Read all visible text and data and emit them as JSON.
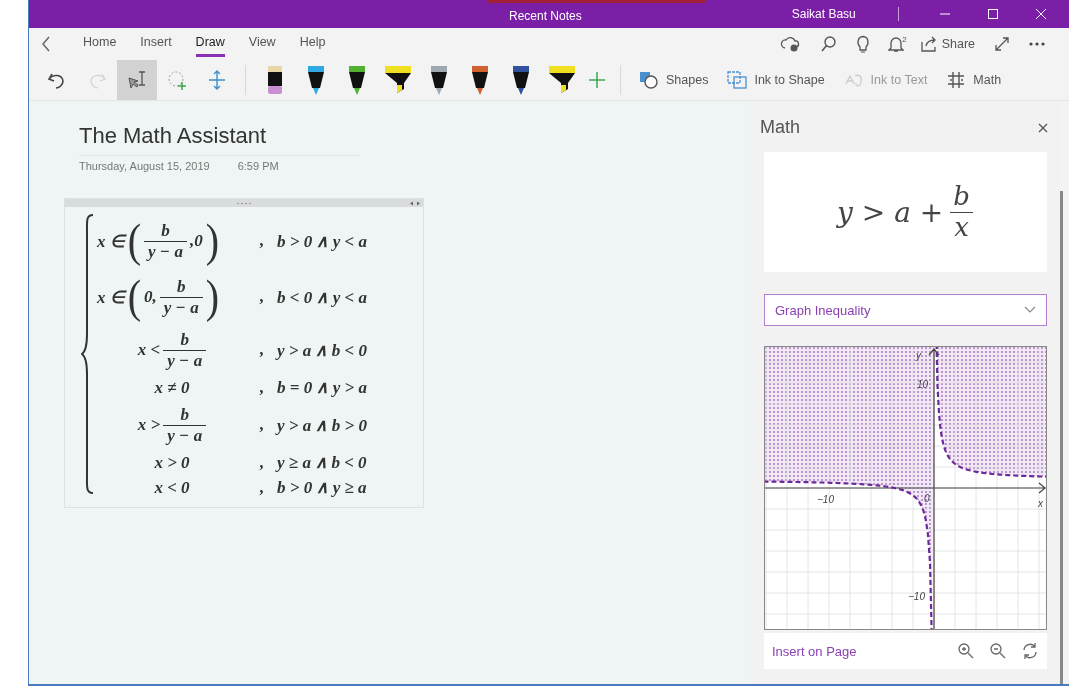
{
  "title_bar": {
    "title": "Recent Notes",
    "user": "Saikat Basu"
  },
  "ribbon_tabs": [
    {
      "label": "Home",
      "selected": false
    },
    {
      "label": "Insert",
      "selected": false
    },
    {
      "label": "Draw",
      "selected": true
    },
    {
      "label": "View",
      "selected": false
    },
    {
      "label": "Help",
      "selected": false
    }
  ],
  "top_actions": [
    {
      "kind": "sync"
    },
    {
      "kind": "search"
    },
    {
      "kind": "lightbulb"
    },
    {
      "kind": "bell",
      "badge": "2"
    },
    {
      "kind": "share",
      "label": "Share"
    },
    {
      "kind": "expand"
    },
    {
      "kind": "more"
    }
  ],
  "history_tools": [
    {
      "kind": "undo",
      "disabled": false
    },
    {
      "kind": "redo",
      "disabled": true
    }
  ],
  "draw_tools": [
    {
      "kind": "type-select",
      "selected": true
    },
    {
      "kind": "lasso",
      "selected": false
    },
    {
      "kind": "space",
      "selected": false
    }
  ],
  "pens": [
    {
      "kind": "marker",
      "color": "#c890d0"
    },
    {
      "kind": "pen",
      "color": "#30a8e0"
    },
    {
      "kind": "pen",
      "color": "#50b030"
    },
    {
      "kind": "highlighter",
      "color": "#f0e020"
    },
    {
      "kind": "pen",
      "color": "#a0a8b0"
    },
    {
      "kind": "pen",
      "color": "#d06030"
    },
    {
      "kind": "pen",
      "color": "#3050a0"
    },
    {
      "kind": "highlighter",
      "color": "#f0e020"
    }
  ],
  "ink_actions": [
    {
      "kind": "shapes",
      "label": "Shapes",
      "disabled": false
    },
    {
      "kind": "ink-to-shape",
      "label": "Ink to Shape",
      "disabled": false
    },
    {
      "kind": "ink-to-text",
      "label": "Ink to Text",
      "disabled": true
    },
    {
      "kind": "math",
      "label": "Math",
      "disabled": false
    }
  ],
  "page": {
    "title": "The Math Assistant",
    "date": "Thursday, August 15, 2019",
    "time": "6:59 PM",
    "cases": [
      {
        "left": [
          {
            "kind": "text",
            "t": "x ∈"
          },
          {
            "kind": "paren",
            "t": "("
          },
          {
            "kind": "fraction",
            "num": "b",
            "den": "y − a"
          },
          {
            "kind": "text",
            "t": ",0"
          },
          {
            "kind": "paren",
            "t": ")"
          }
        ],
        "sep": ",",
        "cond": "b > 0 ∧ y < a"
      },
      {
        "left": [
          {
            "kind": "text",
            "t": "x ∈"
          },
          {
            "kind": "paren",
            "t": "("
          },
          {
            "kind": "text",
            "t": "0,"
          },
          {
            "kind": "fraction",
            "num": "b",
            "den": "y − a"
          },
          {
            "kind": "paren",
            "t": ")"
          }
        ],
        "sep": ",",
        "cond": "b < 0 ∧ y < a"
      },
      {
        "left": [
          {
            "kind": "text",
            "t": "x <"
          },
          {
            "kind": "fraction",
            "num": "b",
            "den": "y − a"
          }
        ],
        "sep": ",",
        "cond": "y > a ∧ b < 0"
      },
      {
        "left": [
          {
            "kind": "text",
            "t": "x ≠ 0"
          }
        ],
        "sep": ",",
        "cond": "b = 0 ∧ y > a"
      },
      {
        "left": [
          {
            "kind": "text",
            "t": "x >"
          },
          {
            "kind": "fraction",
            "num": "b",
            "den": "y − a"
          }
        ],
        "sep": ",",
        "cond": "y > a ∧ b > 0"
      },
      {
        "left": [
          {
            "kind": "text",
            "t": "x > 0"
          }
        ],
        "sep": ",",
        "cond": "y ≥ a ∧ b < 0"
      },
      {
        "left": [
          {
            "kind": "text",
            "t": "x < 0"
          }
        ],
        "sep": ",",
        "cond": "b > 0 ∧ y ≥ a"
      }
    ]
  },
  "math_pane": {
    "title": "Math",
    "expression": [
      {
        "kind": "text",
        "t": "y > a +"
      },
      {
        "kind": "fraction",
        "num": "b",
        "den": "x"
      }
    ],
    "action": "Graph Inequality",
    "graph": {
      "y_axis_label": "y",
      "x_axis_label": "x",
      "y_ticks": [
        "10",
        "−10"
      ],
      "x_ticks": [
        "−10"
      ],
      "origin": "0"
    },
    "insert_link": "Insert on Page"
  }
}
